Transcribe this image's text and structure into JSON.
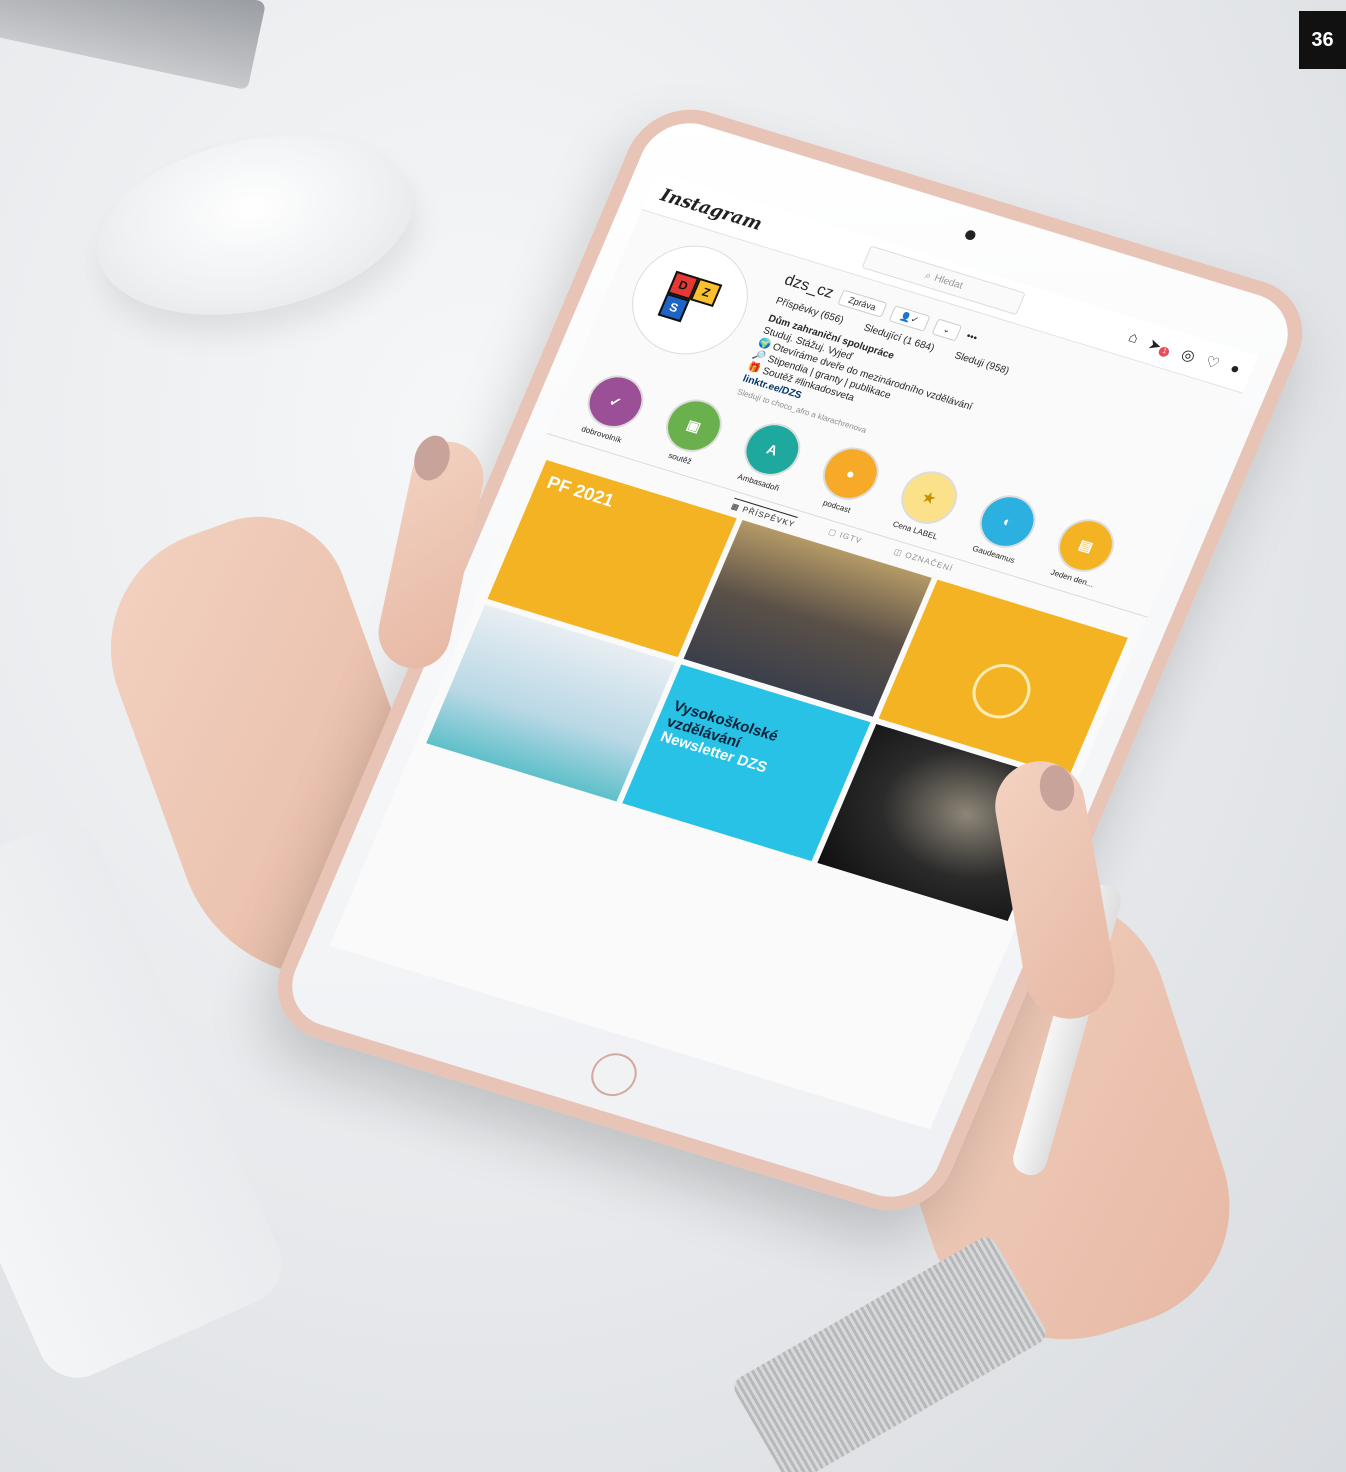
{
  "page_number": "36",
  "instagram": {
    "logo": "Instagram",
    "search_placeholder": "Hledat",
    "notification_count": "1",
    "username": "dzs_cz",
    "message_button": "Zpráva",
    "more": "•••",
    "counts": {
      "posts": "Příspěvky (656)",
      "followers": "Sledující (1 684)",
      "following": "Sleduji (958)"
    },
    "bio": {
      "name": "Dům zahraniční spolupráce",
      "line1": "Studuj. Stážuj. Vyjeď",
      "line2": "Otevíráme dveře do mezinárodního vzdělávání",
      "line3": "Stipendia | granty | publikace",
      "line4": "Soutěž #linkadosveta",
      "link": "linktr.ee/DZS",
      "followed_by": "Sledují to choco_afro a klarachrenova"
    },
    "logo_letters": {
      "d": "D",
      "z": "Z",
      "s": "S"
    },
    "highlights": [
      {
        "label": "dobrovolník",
        "color": "#9b4f96",
        "glyph": "✓"
      },
      {
        "label": "soutěž",
        "color": "#6ab04c",
        "glyph": "▣"
      },
      {
        "label": "Ambasadoři",
        "color": "#1fa89e",
        "glyph": "A"
      },
      {
        "label": "podcast",
        "color": "#f7a928",
        "glyph": "●"
      },
      {
        "label": "Cena LABEL",
        "color": "#fbe28a",
        "glyph": "★"
      },
      {
        "label": "Gaudeamus",
        "color": "#2cb0e0",
        "glyph": "◐"
      },
      {
        "label": "Jeden den...",
        "color": "#f4b323",
        "glyph": "▤"
      }
    ],
    "tabs": {
      "posts": "PŘÍSPĚVKY",
      "igtv": "IGTV",
      "tagged": "OZNAČENÍ"
    },
    "posts": {
      "pf_title": "PF 2021",
      "news_line1": "Vysokoškolské",
      "news_line2": "vzdělávání",
      "news_line3": "Newsletter DZS"
    }
  }
}
